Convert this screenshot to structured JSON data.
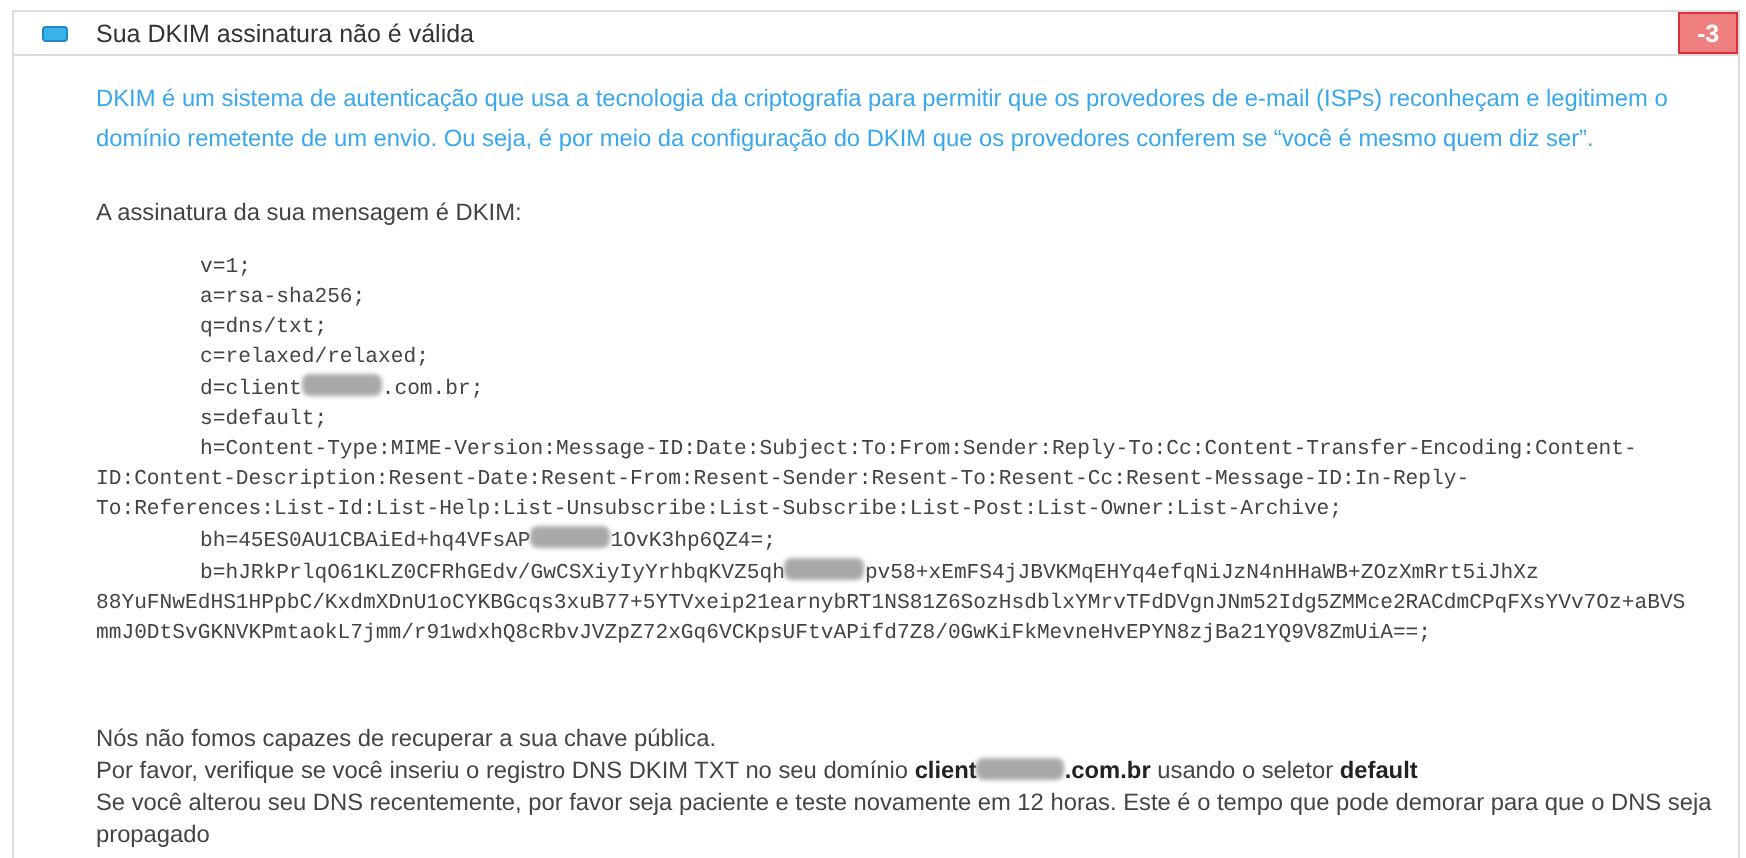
{
  "header": {
    "title": "Sua DKIM assinatura não é válida",
    "score": "-3"
  },
  "intro": "DKIM é um sistema de autenticação que usa a tecnologia da criptografia para permitir que os provedores de e-mail (ISPs) reconheçam e legitimem o domínio remetente de um envio. Ou seja, é por meio da configuração do DKIM que os provedores conferem se “você é mesmo quem diz ser”.",
  "signature_label": "A assinatura da sua mensagem é DKIM:",
  "signature_lines": [
    {
      "indented": true,
      "parts": [
        {
          "kind": "text",
          "text": "v=1;"
        }
      ]
    },
    {
      "indented": true,
      "parts": [
        {
          "kind": "text",
          "text": "a=rsa-sha256;"
        }
      ]
    },
    {
      "indented": true,
      "parts": [
        {
          "kind": "text",
          "text": "q=dns/txt;"
        }
      ]
    },
    {
      "indented": true,
      "parts": [
        {
          "kind": "text",
          "text": "c=relaxed/relaxed;"
        }
      ]
    },
    {
      "indented": true,
      "parts": [
        {
          "kind": "text",
          "text": "d=client"
        },
        {
          "kind": "redaction"
        },
        {
          "kind": "text",
          "text": ".com.br;"
        }
      ]
    },
    {
      "indented": true,
      "parts": [
        {
          "kind": "text",
          "text": "s=default;"
        }
      ]
    },
    {
      "indented": true,
      "parts": [
        {
          "kind": "text",
          "text": "h=Content-Type:MIME-Version:Message-ID:Date:Subject:To:From:Sender:Reply-To:Cc:Content-Transfer-Encoding:Content-"
        }
      ]
    },
    {
      "indented": false,
      "parts": [
        {
          "kind": "text",
          "text": "ID:Content-Description:Resent-Date:Resent-From:Resent-Sender:Resent-To:Resent-Cc:Resent-Message-ID:In-Reply-"
        }
      ]
    },
    {
      "indented": false,
      "parts": [
        {
          "kind": "text",
          "text": "To:References:List-Id:List-Help:List-Unsubscribe:List-Subscribe:List-Post:List-Owner:List-Archive;"
        }
      ]
    },
    {
      "indented": true,
      "parts": [
        {
          "kind": "text",
          "text": "bh=45ES0AU1CBAiEd+hq4VFsAP"
        },
        {
          "kind": "redaction"
        },
        {
          "kind": "text",
          "text": "1OvK3hp6QZ4=;"
        }
      ]
    },
    {
      "indented": true,
      "parts": [
        {
          "kind": "text",
          "text": "b=hJRkPrlqO61KLZ0CFRhGEdv/GwCSXiyIyYrhbqKVZ5qh"
        },
        {
          "kind": "redaction"
        },
        {
          "kind": "text",
          "text": "pv58+xEmFS4jJBVKMqEHYq4efqNiJzN4nHHaWB+ZOzXmRrt5iJhXz"
        }
      ]
    },
    {
      "indented": false,
      "parts": [
        {
          "kind": "text",
          "text": "88YuFNwEdHS1HPpbC/KxdmXDnU1oCYKBGcqs3xuB77+5YTVxeip21earnybRT1NS81Z6SozHsdblxYMrvTFdDVgnJNm52Idg5ZMMce2RACdmCPqFXsYVv7Oz+aBVS"
        }
      ]
    },
    {
      "indented": false,
      "parts": [
        {
          "kind": "text",
          "text": "mmJ0DtSvGKNVKPmtaokL7jmm/r91wdxhQ8cRbvJVZpZ72xGq6VCKpsUFtvAPifd7Z8/0GwKiFkMevneHvEPYN8zjBa21YQ9V8ZmUiA==;"
        }
      ]
    }
  ],
  "messages": [
    {
      "parts": [
        {
          "kind": "text",
          "text": "Nós não fomos capazes de recuperar a sua chave pública."
        }
      ]
    },
    {
      "parts": [
        {
          "kind": "text",
          "text": "Por favor, verifique se você inseriu o registro DNS DKIM TXT no seu domínio "
        },
        {
          "kind": "bold",
          "text": "client"
        },
        {
          "kind": "redaction"
        },
        {
          "kind": "bold",
          "text": ".com.br"
        },
        {
          "kind": "text",
          "text": " usando o seletor "
        },
        {
          "kind": "bold",
          "text": "default"
        }
      ]
    },
    {
      "parts": [
        {
          "kind": "text",
          "text": "Se você alterou seu DNS recentemente, por favor seja paciente e teste novamente em 12 horas. Este é o tempo que pode demorar para que o DNS seja propagado"
        }
      ]
    }
  ]
}
